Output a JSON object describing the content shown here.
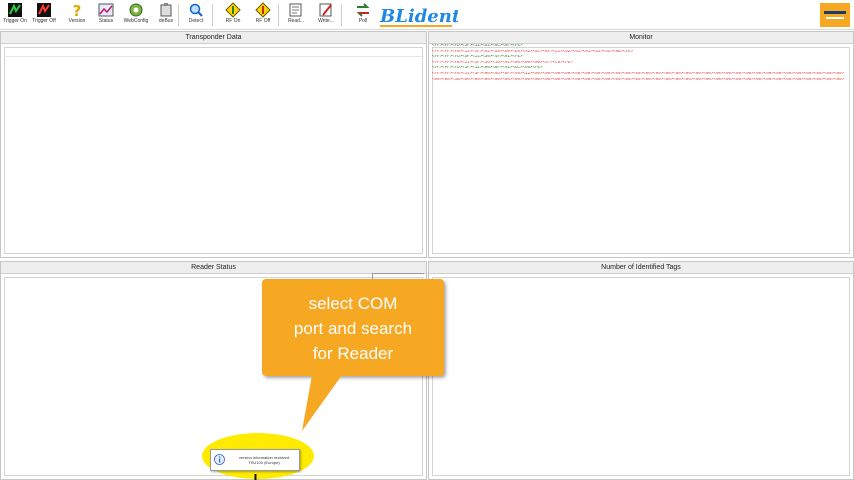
{
  "toolbar": {
    "buttons": [
      {
        "label": "Trigger On",
        "icon": "trigger-on-icon"
      },
      {
        "label": "Trigger Off",
        "icon": "trigger-off-icon"
      },
      {
        "label": "Version",
        "icon": "version-icon"
      },
      {
        "label": "Status",
        "icon": "status-icon"
      },
      {
        "label": "WebConfig",
        "icon": "webconfig-icon"
      },
      {
        "label": "deBus",
        "icon": "debus-icon"
      },
      {
        "label": "Detect",
        "icon": "detect-icon"
      },
      {
        "label": "RF On",
        "icon": "rf-on-icon"
      },
      {
        "label": "RF Off",
        "icon": "rf-off-icon"
      },
      {
        "label": "Read...",
        "icon": "read-icon"
      },
      {
        "label": "Write...",
        "icon": "write-icon"
      },
      {
        "label": "Poll",
        "icon": "poll-icon"
      }
    ]
  },
  "logo": {
    "text": "BLident"
  },
  "panels": {
    "transponder_title": "Transponder Data",
    "monitor_title": "Monitor",
    "reader_title": "Reader Status",
    "tags_title": "Number of Identified Tags"
  },
  "monitor": {
    "lines": [
      {
        "dir": "tx",
        "text": "<FF><FF><FD><3F><11><52><9C><9F><FE>"
      },
      {
        "dir": "rx",
        "text": "<FF><FF><FB><11><3F><52><59><D0><E6><A2><0C><8F><21><52><01><01><52><4C><0B><FE>"
      },
      {
        "dir": "tx",
        "text": "<FF><FF><FD><3F><11><30><4F><01><FE>"
      },
      {
        "dir": "rx",
        "text": "<FF><FF><FB><11><3F><30><10><01><00><00><00><57><C9><FE>"
      },
      {
        "dir": "tx",
        "text": "<FF><FF><FD><3F><11><00><8F><41><DC><56><FE>"
      },
      {
        "dir": "rx",
        "text": "<FF><FF><FB><11><3F><00><5D><8F><40><12><00><00><00><00><00><00><00><00><00><00><00><00><00><00><00><00><00><00><00><00><00><00><00><00><00><00><00><00><00><00><00><00><00><00><00><00><00><00>"
      },
      {
        "dir": "rx",
        "text": "<00><00><1B><00><00><00><00><00><00><00><00><00><00><00><00><00><00><00><00><00><00><00><00><00><00><00><00><00><00><00><00><00><00><00><00><00><00><00><00><00><00><00><00><A8><21><FE>"
      }
    ]
  },
  "callout": {
    "line1": "select COM",
    "line2": "port and search",
    "line3": "for Reader"
  },
  "notification": {
    "line1": "version information received",
    "line2": "TSU100 (Europe)"
  },
  "colors": {
    "callout": "#f7a823",
    "highlight": "#ffeb00",
    "monitor_tx": "#2a7a2a",
    "monitor_rx": "#e53935"
  }
}
